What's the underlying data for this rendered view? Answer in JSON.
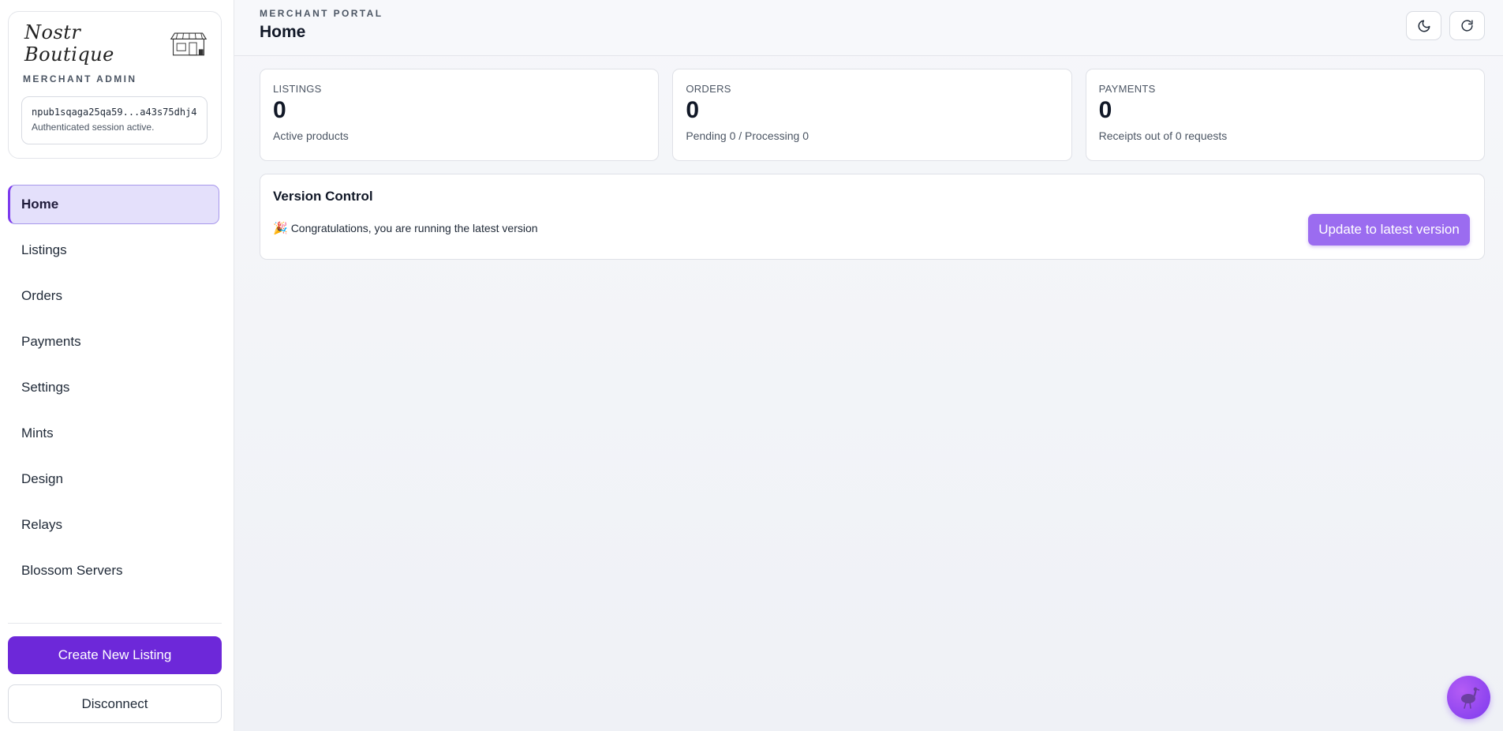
{
  "sidebar": {
    "logo_text": "Nostr Boutique",
    "brand_subtitle": "MERCHANT ADMIN",
    "npub": "npub1sqaga25qa59...a43s75dhj4",
    "session_status": "Authenticated session active.",
    "nav": [
      {
        "label": "Home",
        "active": true
      },
      {
        "label": "Listings"
      },
      {
        "label": "Orders"
      },
      {
        "label": "Payments"
      },
      {
        "label": "Settings"
      },
      {
        "label": "Mints"
      },
      {
        "label": "Design"
      },
      {
        "label": "Relays"
      },
      {
        "label": "Blossom Servers"
      }
    ],
    "create_label": "Create New Listing",
    "disconnect_label": "Disconnect"
  },
  "header": {
    "eyebrow": "MERCHANT PORTAL",
    "title": "Home",
    "actions": [
      {
        "icon": "moon-icon"
      },
      {
        "icon": "refresh-icon"
      }
    ]
  },
  "stats": [
    {
      "label": "LISTINGS",
      "value": "0",
      "desc": "Active products"
    },
    {
      "label": "ORDERS",
      "value": "0",
      "desc": "Pending 0 / Processing 0"
    },
    {
      "label": "PAYMENTS",
      "value": "0",
      "desc": "Receipts out of 0 requests"
    }
  ],
  "version": {
    "title": "Version Control",
    "emoji": "🎉",
    "message": "Congratulations, you are running the latest version",
    "button": "Update to latest version"
  },
  "colors": {
    "accent": "#6d28d9",
    "accent_light": "#9b6cf0",
    "active_nav_bg": "#e4e0fb"
  },
  "fab": {
    "icon": "ostrich-icon"
  }
}
